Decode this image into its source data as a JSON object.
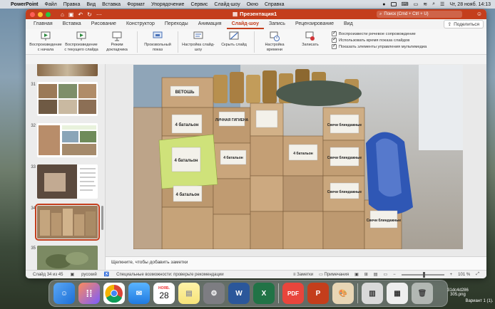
{
  "menubar": {
    "app": "PowerPoint",
    "items": [
      "Файл",
      "Правка",
      "Вид",
      "Вставка",
      "Формат",
      "Упорядочение",
      "Сервис",
      "Слайд-шоу",
      "Окно",
      "Справка"
    ],
    "datetime": "Чт, 28 нояб.  14:13"
  },
  "window": {
    "title": "Презентация1",
    "search_placeholder": "Поиск (Cmd + Ctrl + U)"
  },
  "tabs": [
    "Главная",
    "Вставка",
    "Рисование",
    "Конструктор",
    "Переходы",
    "Анимация",
    "Слайд-шоу",
    "Запись",
    "Рецензирование",
    "Вид"
  ],
  "active_tab": "Слайд-шоу",
  "share_label": "Поделиться",
  "ribbon": {
    "buttons": [
      {
        "label": "Воспроизведение с начала"
      },
      {
        "label": "Воспроизведение с текущего слайда"
      },
      {
        "label": "Режим докладчика"
      },
      {
        "label": "Произвольный показ"
      },
      {
        "label": "Настройка слайд-шоу"
      },
      {
        "label": "Скрыть слайд"
      },
      {
        "label": "Настройка времени"
      },
      {
        "label": "Записать"
      }
    ],
    "checkboxes": [
      {
        "label": "Воспроизвести речевое сопровождение",
        "checked": true
      },
      {
        "label": "Использовать время показа слайдов",
        "checked": true
      },
      {
        "label": "Показать элементы управления мультимедиа",
        "checked": true
      }
    ]
  },
  "thumbnails": [
    {
      "num": "31"
    },
    {
      "num": "32"
    },
    {
      "num": "33"
    },
    {
      "num": "34",
      "selected": true
    },
    {
      "num": "35"
    }
  ],
  "notes_placeholder": "Щелкните, чтобы добавить заметки",
  "status": {
    "slide": "Слайд 34 из 45",
    "language": "русский",
    "accessibility": "Специальные возможности: проверьте рекомендации",
    "notes": "Заметки",
    "comments": "Примечания",
    "zoom": "101 %"
  },
  "box_labels": {
    "vetosh": "ВЕТОШЬ",
    "batalon": "4 батальон",
    "svechi": "Свечи блиндажные",
    "gigiena": "ЛИЧНАЯ ГИГИЕНА"
  },
  "dock": {
    "calendar_month": "НОЯБ.",
    "calendar_day": "28",
    "desktop_file1": "31dc4d286 305.png",
    "desktop_file2": "Вариант 1 (1)."
  }
}
